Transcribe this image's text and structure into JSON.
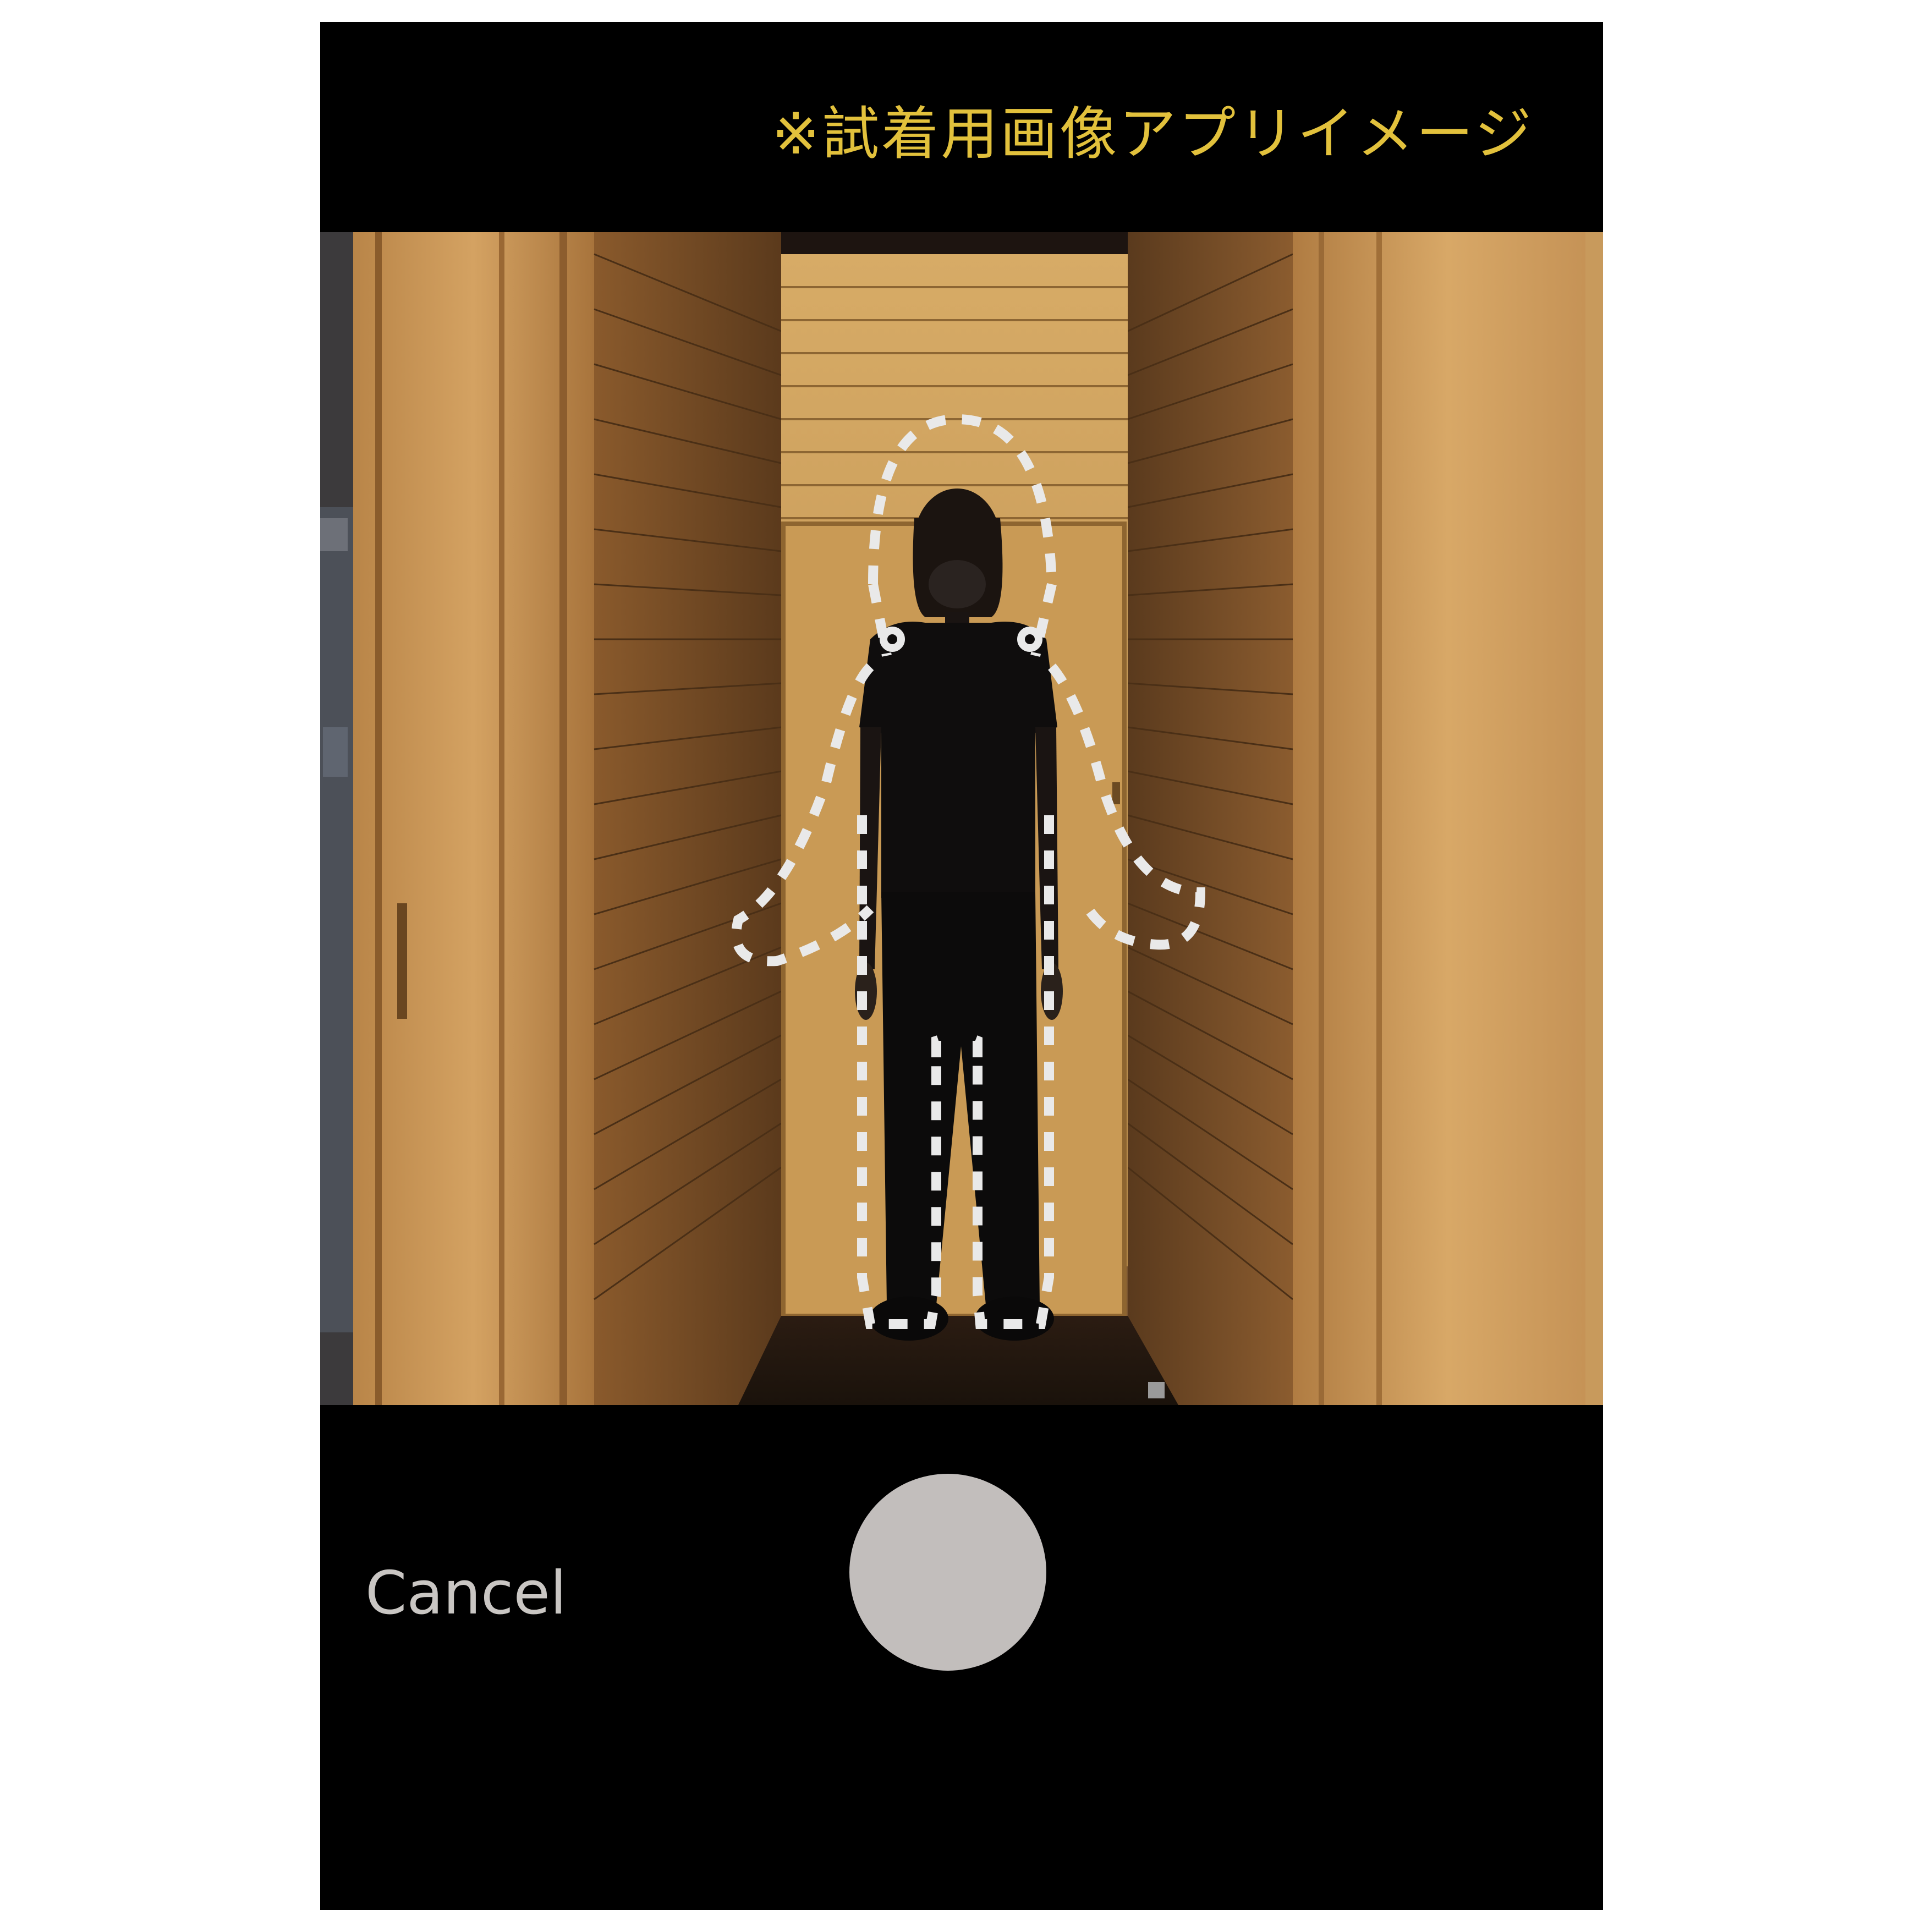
{
  "header": {
    "notice_text": "※試着用画像アプリイメージ"
  },
  "camera": {
    "scene": "person standing in wooden hallway",
    "guide_overlay": "dashed body outline"
  },
  "controls": {
    "cancel_label": "Cancel",
    "shutter_icon": "shutter-button"
  },
  "colors": {
    "notice": "#e2c13c",
    "shutter": "#c2bebc",
    "cancel": "#c9c6c3",
    "guide_line": "#e9e9e9",
    "background": "#000000"
  }
}
